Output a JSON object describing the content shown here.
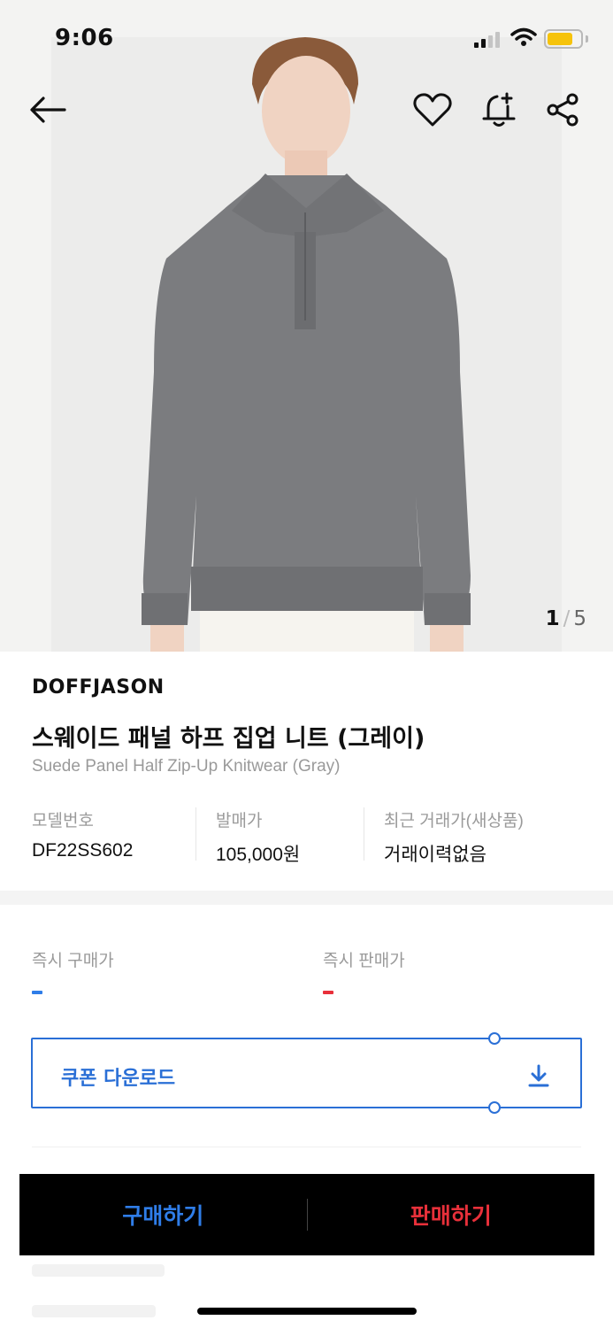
{
  "status_bar": {
    "time": "9:06"
  },
  "gallery": {
    "current": "1",
    "total": "5",
    "separator": "/"
  },
  "product": {
    "brand": "DOFFJASON",
    "title_ko": "스웨이드 패널 하프 집업 니트 (그레이)",
    "title_en": "Suede Panel Half Zip-Up Knitwear (Gray)",
    "specs": [
      {
        "label": "모델번호",
        "value": "DF22SS602"
      },
      {
        "label": "발매가",
        "value": "105,000원"
      },
      {
        "label": "최근 거래가(새상품)",
        "value": "거래이력없음"
      }
    ]
  },
  "prices": {
    "instant_buy_label": "즉시 구매가",
    "instant_sell_label": "즉시 판매가",
    "buy_color": "#2f7de8",
    "sell_color": "#e8303a"
  },
  "coupon": {
    "label": "쿠폰 다운로드",
    "icon": "download-icon"
  },
  "actions": {
    "buy_label": "구매하기",
    "sell_label": "판매하기"
  },
  "icons": [
    "back-arrow-icon",
    "heart-icon",
    "bell-plus-icon",
    "share-icon",
    "download-icon"
  ],
  "colors": {
    "accent_blue": "#2a6fd6",
    "battery": "#f6c30b"
  }
}
